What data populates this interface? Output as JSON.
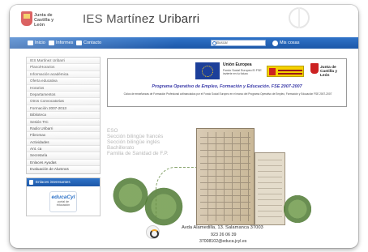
{
  "header": {
    "logo_text_1": "Junta de",
    "logo_text_2": "Castilla y León",
    "title": "IES Martínez Uribarri"
  },
  "nav": {
    "items": [
      {
        "label": "Inicio"
      },
      {
        "label": "Informes"
      },
      {
        "label": "Contacto"
      }
    ],
    "search_placeholder": "Buscar",
    "access_label": "Mis cosas"
  },
  "sidebar": {
    "menu": [
      "IES Martínez Uribarri",
      "Plano/Horarios",
      "Información académica",
      "Oferta educativa",
      "Horarios",
      "Departamentos",
      "Otros Convocatorias",
      "Formación 2007-2013",
      "Biblioteca",
      "Sesión TIC",
      "Radio Uribarri",
      "Fibromax",
      "Actividades",
      "Ant. ca",
      "Secretaría",
      "Enlaces Ayudas",
      "Evaluación de Alumnos"
    ],
    "panel_title": "Enlaces interesantes",
    "educacyl_brand": "educaCyl",
    "educacyl_sub_1": "portal de",
    "educacyl_sub_2": "educación"
  },
  "banner": {
    "ue_title": "Unión Europea",
    "ue_fund": "Fondo Social Europeo El FSE invierte en tu futuro",
    "jcyl_1": "Junta de",
    "jcyl_2": "Castilla y León",
    "programa": "Programa Operativo de Empleo, Formación y Educación. FSE 2007-2007",
    "note": "Ciclos de enseñanzas de Formación Profesional cofinanciados por el Fondo Social Europeo en el marco del Programa Operativo de Empleo, Formación y Educación FSE 2007-2007"
  },
  "main": {
    "courses": [
      "ESO",
      "Sección bilingüe francés",
      "Sección bilingüe inglés",
      "Bachillerato",
      "Familia de Sanidad de F.P."
    ]
  },
  "footer": {
    "address": "Avda Alamedilla, 13. Salamanca 37003",
    "phone": "923 26 06 39",
    "email": "37008102@educa.jcyl.es"
  },
  "colors": {
    "nav_blue": "#1c57a8",
    "programa_text": "#3b3ba8"
  }
}
